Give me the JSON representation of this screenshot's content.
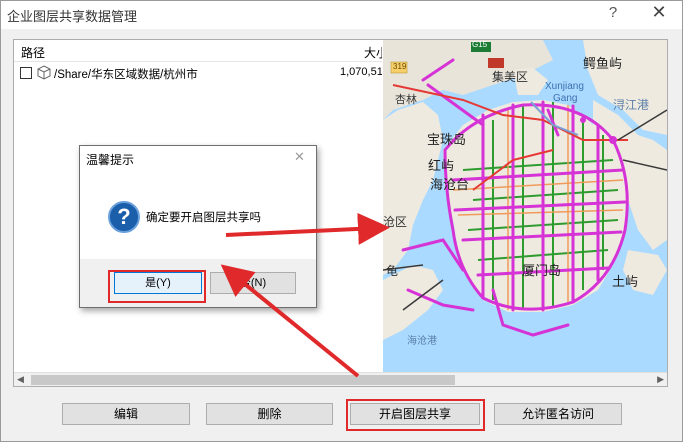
{
  "window": {
    "title": "企业图层共享数据管理",
    "help_glyph": "?",
    "close_glyph": "✕"
  },
  "list": {
    "headers": {
      "path": "路径",
      "size": "大小"
    },
    "rows": [
      {
        "path": "/Share/华东区域数据/杭州市",
        "size": "1,070,51"
      }
    ]
  },
  "map": {
    "labels": {
      "g15": "G15",
      "r319": "319",
      "jimei": "集美区",
      "xinglin": "杏林",
      "eluyu": "鳄鱼屿",
      "xunjiang": "Xunjiang",
      "gang": "Gang",
      "xunjiang_port": "浔江港",
      "baozhu": "宝珠岛",
      "hongyu": "红屿",
      "haicang_tai": "海沧台",
      "haicang": "沧区",
      "gui": "龟",
      "xiamen_island": "厦门岛",
      "tuyu": "土屿",
      "port": "海沧港"
    }
  },
  "buttons": {
    "edit": "编辑",
    "delete": "删除",
    "share": "开启图层共享",
    "anon": "允许匿名访问"
  },
  "dialog": {
    "title": "温馨提示",
    "close_glyph": "✕",
    "icon_glyph": "?",
    "message": "确定要开启图层共享吗",
    "yes": "是(Y)",
    "no": "否(N)"
  },
  "colors": {
    "highlight": "#e0292a",
    "route_magenta": "#d633d6",
    "road_green": "#2e9b2e",
    "water": "#aadaff",
    "land": "#efeae0"
  }
}
